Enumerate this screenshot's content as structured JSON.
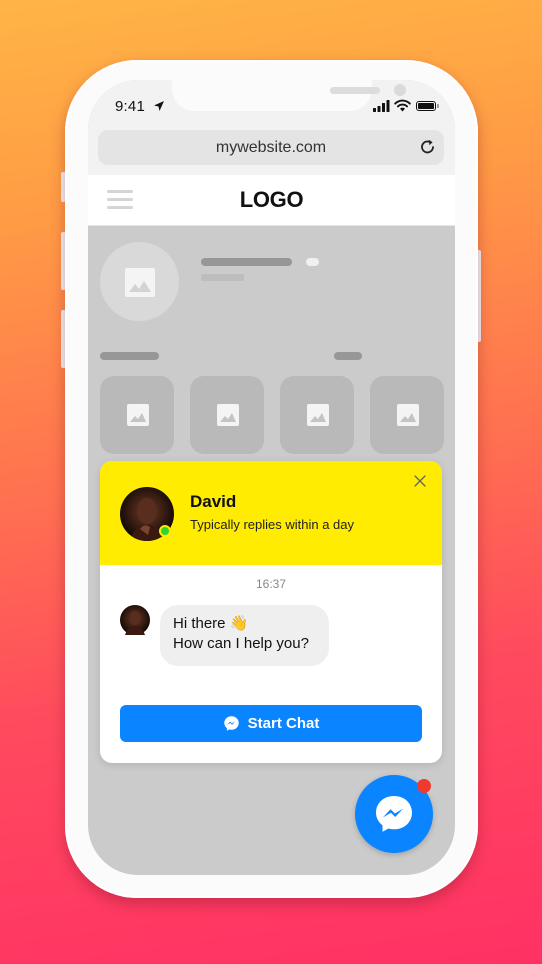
{
  "status_bar": {
    "time": "9:41",
    "location_icon": "location-arrow-icon",
    "signal_icon": "cellular-signal-icon",
    "wifi_icon": "wifi-icon",
    "battery_icon": "battery-full-icon"
  },
  "browser": {
    "url": "mywebsite.com",
    "reload_icon": "reload-icon"
  },
  "site_header": {
    "menu_icon": "hamburger-menu-icon",
    "logo": "LOGO"
  },
  "chat_widget": {
    "agent": {
      "name": "David",
      "status": "Typically replies within a day",
      "online": true
    },
    "close_icon": "close-icon",
    "timestamp": "16:37",
    "messages": [
      {
        "line1": "Hi there 👋",
        "line2": "How can I help you?"
      }
    ],
    "start_button": {
      "label": "Start Chat",
      "icon": "messenger-icon"
    }
  },
  "fab": {
    "icon": "messenger-icon",
    "has_notification": true
  },
  "colors": {
    "accent": "#0a84ff",
    "chat_header": "#ffec00",
    "online": "#2fd42f",
    "notification": "#f03a2e"
  }
}
